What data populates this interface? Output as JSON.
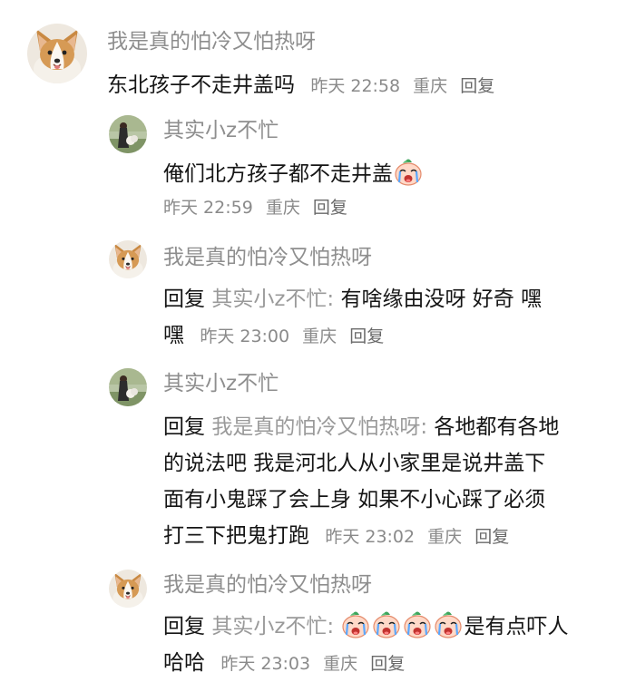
{
  "comments": [
    {
      "username": "我是真的怕冷又怕热呀",
      "text": "东北孩子不走井盖吗",
      "time": "昨天 22:58",
      "location": "重庆",
      "reply_label": "回复"
    },
    {
      "username": "其实小z不忙",
      "text": "俺们北方孩子都不走井盖",
      "emoji": "crying-face-emoji",
      "time": "昨天 22:59",
      "location": "重庆",
      "reply_label": "回复"
    },
    {
      "username": "我是真的怕冷又怕热呀",
      "reply_prefix": "回复",
      "reply_to": "其实小z不忙:",
      "text_line1": "有啥缘由没呀 好奇 嘿",
      "text_line2": "嘿",
      "time": "昨天 23:00",
      "location": "重庆",
      "reply_label": "回复"
    },
    {
      "username": "其实小z不忙",
      "reply_prefix": "回复",
      "reply_to": "我是真的怕冷又怕热呀:",
      "text_line1": "各地都有各地",
      "text_line2": "的说法吧 我是河北人从小家里是说井盖下",
      "text_line3": "面有小鬼踩了会上身 如果不小心踩了必须",
      "text_line4": "打三下把鬼打跑",
      "time": "昨天 23:02",
      "location": "重庆",
      "reply_label": "回复"
    },
    {
      "username": "我是真的怕冷又怕热呀",
      "reply_prefix": "回复",
      "reply_to": "其实小z不忙:",
      "emoji_count": 4,
      "text_line1": "是有点吓人",
      "text_line2": "哈哈",
      "time": "昨天 23:03",
      "location": "重庆",
      "reply_label": "回复"
    }
  ],
  "colors": {
    "username": "#8e8e8e",
    "text": "#151515",
    "meta": "#8a8a8a",
    "background": "#ffffff"
  }
}
